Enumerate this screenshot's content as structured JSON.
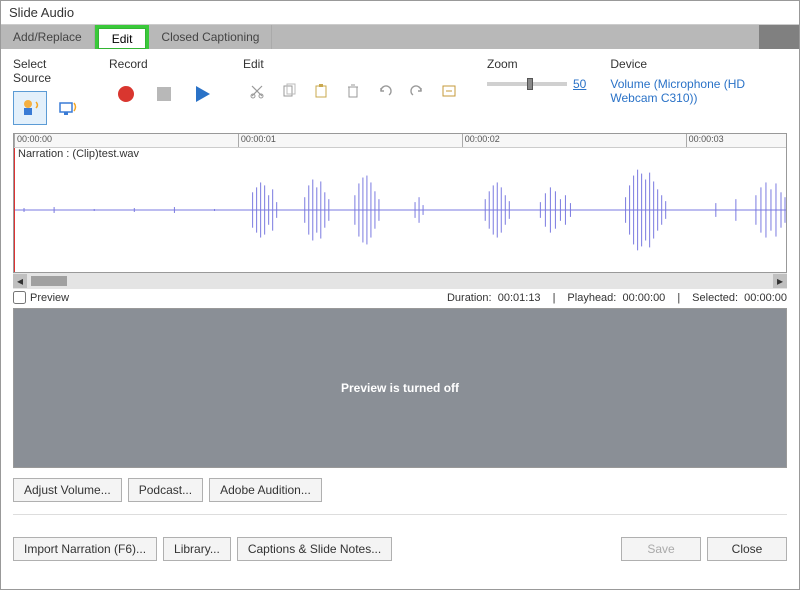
{
  "title": "Slide Audio",
  "tabs": {
    "add_replace": "Add/Replace",
    "edit": "Edit",
    "cc": "Closed Captioning"
  },
  "toolbar": {
    "select_source": "Select Source",
    "record": "Record",
    "edit": "Edit",
    "zoom": "Zoom",
    "device": "Device"
  },
  "zoom_value": "50",
  "device_name": "Volume (Microphone (HD Webcam C310))",
  "ruler_ticks": [
    "00:00:00",
    "00:00:01",
    "00:00:02",
    "00:00:03"
  ],
  "narration_label": "Narration : (Clip)test.wav",
  "preview_checkbox": "Preview",
  "status": {
    "duration_label": "Duration:",
    "duration": "00:01:13",
    "playhead_label": "Playhead:",
    "playhead": "00:00:00",
    "selected_label": "Selected:",
    "selected": "00:00:00"
  },
  "preview_off_text": "Preview is turned off",
  "buttons": {
    "adjust_volume": "Adjust Volume...",
    "podcast": "Podcast...",
    "adobe_audition": "Adobe Audition...",
    "import_narration": "Import Narration (F6)...",
    "library": "Library...",
    "captions_notes": "Captions & Slide Notes...",
    "save": "Save",
    "close": "Close"
  }
}
